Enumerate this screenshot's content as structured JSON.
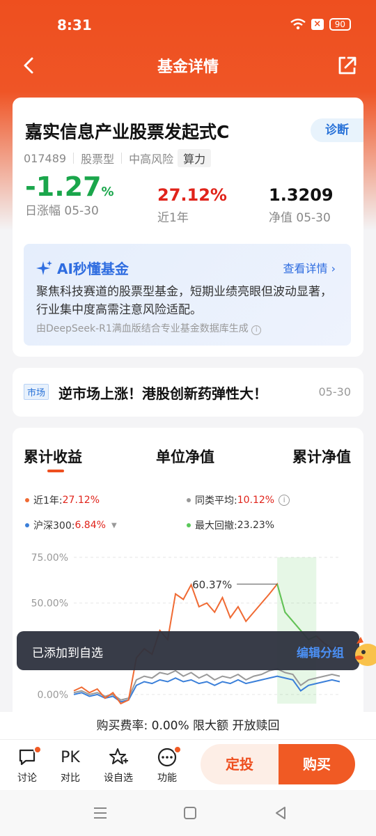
{
  "status_bar": {
    "time": "8:31",
    "battery": "90"
  },
  "navbar": {
    "title": "基金详情"
  },
  "fund": {
    "name": "嘉实信息产业股票发起式C",
    "diagnose_label": "诊断",
    "code": "017489",
    "type": "股票型",
    "risk": "中高风险",
    "theme": "算力",
    "daily_change": "-1.27",
    "daily_change_unit": "%",
    "daily_change_label": "日涨幅 05-30",
    "one_year_return": "27.12%",
    "one_year_label": "近1年",
    "nav_value": "1.3209",
    "nav_label": "净值 05-30"
  },
  "ai": {
    "title": "AI秒懂基金",
    "link": "查看详情",
    "text": "聚焦科技赛道的股票型基金，短期业绩亮眼但波动显著，行业集中度高需注意风险适配。",
    "note": "由DeepSeek-R1满血版结合专业基金数据库生成"
  },
  "news": {
    "tag": "市场",
    "text": "逆市场上涨！港股创新药弹性大！",
    "date": "05-30"
  },
  "chart_tabs": [
    "累计收益",
    "单位净值",
    "累计净值"
  ],
  "legend": {
    "fund_label": "近1年:",
    "fund_value": "27.12%",
    "peer_label": "同类平均:",
    "peer_value": "10.12%",
    "index_label": "沪深300:",
    "index_value": "6.84%",
    "drawdown_label": "最大回撤:",
    "drawdown_value": "23.23%"
  },
  "chart_data": {
    "type": "line",
    "y_ticks": [
      "75.00%",
      "50.00%",
      "0.00%"
    ],
    "peak_label": "60.37%",
    "series": [
      {
        "name": "近1年",
        "color": "#f06a33",
        "values": [
          2,
          4,
          1,
          3,
          -2,
          1,
          -5,
          -3,
          20,
          25,
          22,
          35,
          30,
          55,
          52,
          60,
          48,
          50,
          45,
          53,
          42,
          48,
          40,
          45,
          50,
          55,
          60.37,
          45,
          40,
          35,
          30,
          32,
          28,
          25,
          27
        ]
      },
      {
        "name": "同类平均",
        "color": "#999999",
        "values": [
          1,
          2,
          0,
          1,
          -1,
          0,
          -3,
          -2,
          8,
          10,
          9,
          12,
          11,
          13,
          10,
          12,
          9,
          11,
          8,
          10,
          9,
          11,
          8,
          10,
          11,
          13,
          14,
          12,
          11,
          5,
          8,
          9,
          10,
          11,
          10
        ]
      },
      {
        "name": "沪深300",
        "color": "#3a7fd9",
        "values": [
          0,
          1,
          -1,
          0,
          -2,
          -1,
          -4,
          -3,
          5,
          7,
          6,
          8,
          7,
          9,
          7,
          8,
          6,
          7,
          5,
          7,
          6,
          8,
          6,
          7,
          8,
          9,
          10,
          9,
          8,
          2,
          5,
          6,
          7,
          8,
          7
        ]
      }
    ]
  },
  "toast": {
    "message": "已添加到自选",
    "action": "编辑分组"
  },
  "fee_bar": {
    "text": "购买费率: 0.00% 限大额 开放赎回"
  },
  "bottom": {
    "discuss": "讨论",
    "compare_icon": "PK",
    "compare": "对比",
    "watchlist": "设自选",
    "functions": "功能",
    "dingtou": "定投",
    "buy": "购买"
  }
}
